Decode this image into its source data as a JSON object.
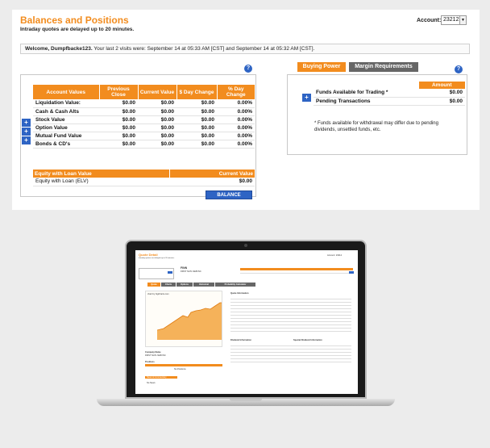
{
  "page": {
    "title": "Balances and Positions",
    "subtitle": "Intraday quotes are delayed up to 20 minutes.",
    "account_label": "Account:",
    "account_value": "23212",
    "welcome_bold": "Welcome, Dumpfbacke123.",
    "welcome_rest": " Your last 2 visits were: September 14 at 05:33 AM [CST] and September 14 at 05:32 AM [CST]."
  },
  "balances": {
    "headers": [
      "Account Values",
      "Previous Close",
      "Current Value",
      "$ Day Change",
      "% Day Change"
    ],
    "rows": [
      {
        "label": "Liquidation Value:",
        "prev": "$0.00",
        "curr": "$0.00",
        "dchg": "$0.00",
        "pchg": "0.00%",
        "expand": false
      },
      {
        "label": "Cash & Cash Alts",
        "prev": "$0.00",
        "curr": "$0.00",
        "dchg": "$0.00",
        "pchg": "0.00%",
        "expand": true
      },
      {
        "label": "Stock Value",
        "prev": "$0.00",
        "curr": "$0.00",
        "dchg": "$0.00",
        "pchg": "0.00%",
        "expand": true
      },
      {
        "label": "Option Value",
        "prev": "$0.00",
        "curr": "$0.00",
        "dchg": "$0.00",
        "pchg": "0.00%",
        "expand": true
      },
      {
        "label": "Mutual Fund Value",
        "prev": "$0.00",
        "curr": "$0.00",
        "dchg": "$0.00",
        "pchg": "0.00%",
        "expand": false
      },
      {
        "label": "Bonds & CD's",
        "prev": "$0.00",
        "curr": "$0.00",
        "dchg": "$0.00",
        "pchg": "0.00%",
        "expand": false
      }
    ],
    "elv_header_left": "Equity with Loan Value",
    "elv_header_right": "Current Value",
    "elv_label": "Equity with Loan (ELV)",
    "elv_value": "$0.00",
    "history_button": "BALANCE HISTORY"
  },
  "buying": {
    "tab_active": "Buying Power",
    "tab_inactive": "Margin Requirements",
    "amount_header": "Amount",
    "rows": [
      {
        "label": "Funds Available for Trading *",
        "value": "$0.00"
      },
      {
        "label": "Pending Transactions",
        "value": "$0.00"
      }
    ],
    "note": "* Funds available for withdrawal may differ due to pending dividends, unsettled funds, etc."
  },
  "help_icon": "?",
  "plus_icon": "+",
  "laptop": {
    "title": "Quote Detail",
    "subtitle": "Intraday quotes are delayed up to 20 minutes.",
    "account": "Account: 23212",
    "symbol": "FINN",
    "company": "FIRST NATL NEB INC",
    "tabs": [
      "Quote",
      "Charts",
      "Options",
      "Historical",
      "Probability Calculator"
    ],
    "chart_caption": "chart by bigCharts.com",
    "company_label": "Company Name",
    "company_value": "FIRST NATL NEB INC",
    "positions_label": "Positions",
    "no_positions": "No Positions",
    "news_label": "News & Commentary",
    "no_news": "No News",
    "quote_info": "Quote Information",
    "dividend_info": "Dividend Information",
    "special_div": "Special Dividend Information"
  },
  "colors": {
    "accent": "#f28c1e",
    "blue": "#2e64c4"
  }
}
